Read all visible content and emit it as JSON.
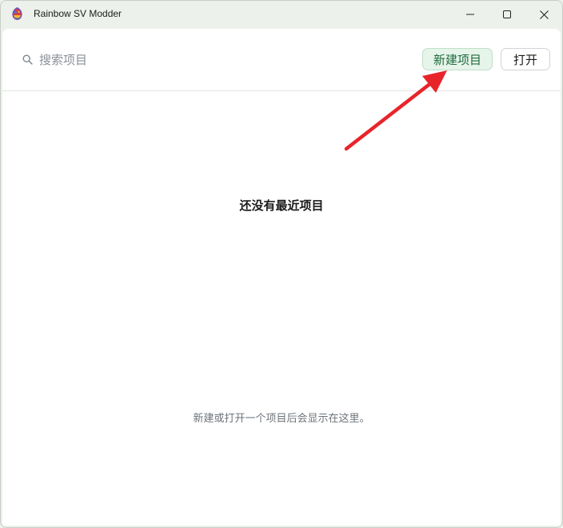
{
  "window": {
    "title": "Rainbow SV Modder",
    "icon": "rainbow-app-icon",
    "controls": [
      "minimize-icon",
      "maximize-icon",
      "close-icon"
    ]
  },
  "header": {
    "search_placeholder": "搜索项目",
    "search_value": "",
    "new_project_label": "新建项目",
    "open_label": "打开"
  },
  "empty_state": {
    "title": "还没有最近项目",
    "subtitle": "新建或打开一个项目后会显示在这里。"
  },
  "annotation": {
    "type": "arrow",
    "color": "#e8242b",
    "points_to": "新建项目"
  },
  "colors": {
    "accent_button_bg": "#e6f4ea",
    "accent_button_text": "#1f6b3d",
    "window_bg": "#edf1eb",
    "annotation_red": "#e8242b"
  }
}
